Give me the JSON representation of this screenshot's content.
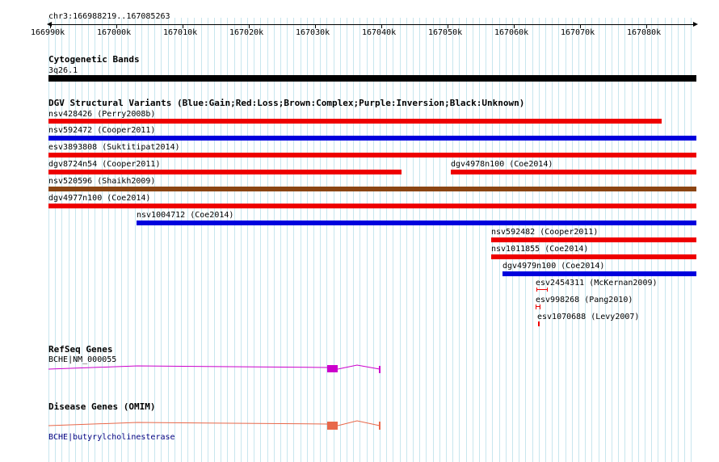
{
  "location": "chr3:166988219..167085263",
  "ruler": {
    "ticks": [
      "166990k",
      "167000k",
      "167010k",
      "167020k",
      "167030k",
      "167040k",
      "167050k",
      "167060k",
      "167070k",
      "167080k"
    ]
  },
  "tracks": {
    "cytoband": {
      "title": "Cytogenetic Bands",
      "band_label": "3q26.1",
      "band_color": "#000000"
    },
    "dgv": {
      "title": "DGV Structural Variants (Blue:Gain;Red:Loss;Brown:Complex;Purple:Inversion;Black:Unknown)",
      "colors": {
        "gain": "#0000dd",
        "loss": "#ee0000",
        "complex": "#8b4513"
      },
      "variants": [
        {
          "label": "nsv428426 (Perry2008b)",
          "type": "loss"
        },
        {
          "label": "nsv592472 (Cooper2011)",
          "type": "gain"
        },
        {
          "label": "esv3893808 (Suktitipat2014)",
          "type": "loss"
        },
        {
          "label": "dgv8724n54 (Cooper2011)",
          "type": "loss"
        },
        {
          "label": "dgv4978n100 (Coe2014)",
          "type": "loss"
        },
        {
          "label": "nsv520596 (Shaikh2009)",
          "type": "complex"
        },
        {
          "label": "dgv4977n100 (Coe2014)",
          "type": "loss"
        },
        {
          "label": "nsv1004712 (Coe2014)",
          "type": "gain"
        },
        {
          "label": "nsv592482 (Cooper2011)",
          "type": "loss"
        },
        {
          "label": "nsv1011855 (Coe2014)",
          "type": "loss"
        },
        {
          "label": "dgv4979n100 (Coe2014)",
          "type": "gain"
        },
        {
          "label": "esv2454311 (McKernan2009)",
          "type": "loss"
        },
        {
          "label": "esv998268 (Pang2010)",
          "type": "loss"
        },
        {
          "label": "esv1070688 (Levy2007)",
          "type": "loss"
        }
      ]
    },
    "refseq": {
      "title": "RefSeq Genes",
      "gene_label": "BCHE|NM_000055",
      "color": "#cc00cc"
    },
    "omim": {
      "title": "Disease Genes (OMIM)",
      "gene_label": "BCHE|butyrylcholinesterase",
      "color": "#e8684a"
    }
  }
}
